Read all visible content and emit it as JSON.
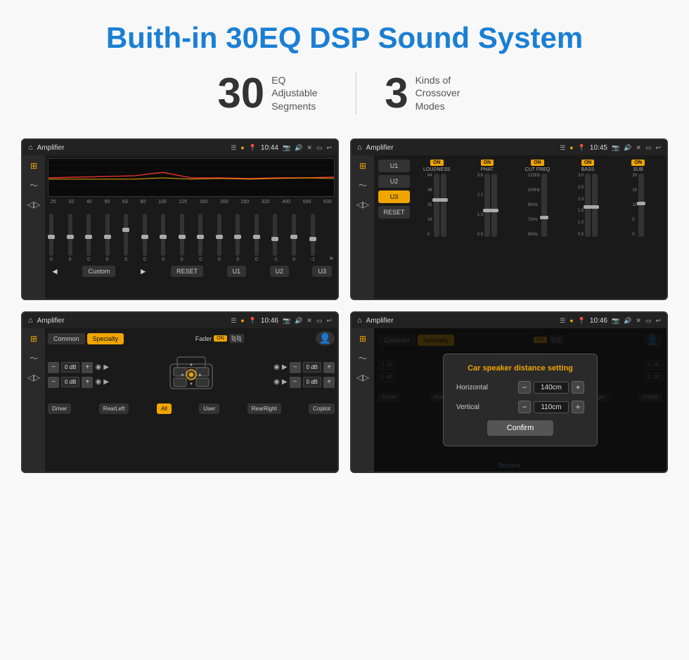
{
  "page": {
    "title": "Buith-in 30EQ DSP Sound System",
    "stats": [
      {
        "number": "30",
        "label": "EQ Adjustable\nSegments"
      },
      {
        "number": "3",
        "label": "Kinds of\nCrossover Modes"
      }
    ]
  },
  "screens": {
    "screen1": {
      "topbar": {
        "title": "Amplifier",
        "time": "10:44"
      },
      "eq_freqs": [
        "25",
        "32",
        "40",
        "50",
        "63",
        "80",
        "100",
        "125",
        "160",
        "200",
        "250",
        "320",
        "400",
        "500",
        "630"
      ],
      "eq_values": [
        "0",
        "0",
        "0",
        "0",
        "5",
        "0",
        "0",
        "0",
        "0",
        "0",
        "0",
        "0",
        "-1",
        "0",
        "-1"
      ],
      "buttons": {
        "custom": "Custom",
        "reset": "RESET",
        "u1": "U1",
        "u2": "U2",
        "u3": "U3"
      }
    },
    "screen2": {
      "topbar": {
        "title": "Amplifier",
        "time": "10:45"
      },
      "channels": [
        {
          "on_badge": "ON",
          "name": "LOUDNESS"
        },
        {
          "on_badge": "ON",
          "name": "PHAT"
        },
        {
          "on_badge": "ON",
          "name": "CUT FREQ"
        },
        {
          "on_badge": "ON",
          "name": "BASS"
        },
        {
          "on_badge": "ON",
          "name": "SUB"
        }
      ],
      "buttons": {
        "u1": "U1",
        "u2": "U2",
        "u3_active": "U3",
        "reset": "RESET"
      }
    },
    "screen3": {
      "topbar": {
        "title": "Amplifier",
        "time": "10:46"
      },
      "btn_common": "Common",
      "btn_specialty": "Specialty",
      "fader_label": "Fader",
      "fader_on": "ON",
      "db_values": [
        "0 dB",
        "0 dB",
        "0 dB",
        "0 dB"
      ],
      "bottom_btns": {
        "driver": "Driver",
        "rear_left": "RearLeft",
        "all_active": "All",
        "user": "User",
        "rear_right": "RearRight",
        "copilot": "Copilot"
      }
    },
    "screen4": {
      "topbar": {
        "title": "Amplifier",
        "time": "10:46"
      },
      "btn_common": "Common",
      "btn_specialty": "Specialty",
      "dialog": {
        "title": "Car speaker distance setting",
        "row1_label": "Horizontal",
        "row1_value": "140cm",
        "row2_label": "Vertical",
        "row2_value": "110cm",
        "confirm_btn": "Confirm"
      },
      "db_values": [
        "0 dB",
        "0 dB"
      ],
      "bottom_btns": {
        "driver": "Driver",
        "rear_left": "RearLeft",
        "all_active": "All",
        "user": "User",
        "rear_right": "RearRight",
        "copilot": "Copilot"
      }
    }
  },
  "watermark": "Seicane"
}
